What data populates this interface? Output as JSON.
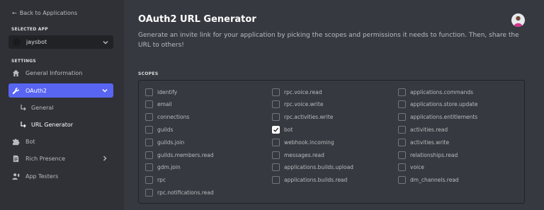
{
  "sidebar": {
    "back_label": "Back to Applications",
    "selected_app_heading": "SELECTED APP",
    "selected_app_name": "jaysbot",
    "settings_heading": "SETTINGS",
    "items": [
      {
        "label": "General Information",
        "icon": "home-icon"
      },
      {
        "label": "OAuth2",
        "icon": "wrench-icon",
        "active": true
      },
      {
        "label": "General",
        "sub": true
      },
      {
        "label": "URL Generator",
        "sub": true,
        "selected": true
      },
      {
        "label": "Bot",
        "icon": "puzzle-icon"
      },
      {
        "label": "Rich Presence",
        "icon": "document-icon",
        "expandable": true
      },
      {
        "label": "App Testers",
        "icon": "user-phone-icon"
      }
    ]
  },
  "main": {
    "title": "OAuth2 URL Generator",
    "description": "Generate an invite link for your application by picking the scopes and permissions it needs to function. Then, share the URL to others!",
    "scopes_heading": "SCOPES",
    "scopes": [
      {
        "label": "identify",
        "checked": false
      },
      {
        "label": "email",
        "checked": false
      },
      {
        "label": "connections",
        "checked": false
      },
      {
        "label": "guilds",
        "checked": false
      },
      {
        "label": "guilds.join",
        "checked": false
      },
      {
        "label": "guilds.members.read",
        "checked": false
      },
      {
        "label": "gdm.join",
        "checked": false
      },
      {
        "label": "rpc",
        "checked": false
      },
      {
        "label": "rpc.notifications.read",
        "checked": false
      },
      {
        "label": "rpc.voice.read",
        "checked": false
      },
      {
        "label": "rpc.voice.write",
        "checked": false
      },
      {
        "label": "rpc.activities.write",
        "checked": false
      },
      {
        "label": "bot",
        "checked": true
      },
      {
        "label": "webhook.incoming",
        "checked": false
      },
      {
        "label": "messages.read",
        "checked": false
      },
      {
        "label": "applications.builds.upload",
        "checked": false
      },
      {
        "label": "applications.builds.read",
        "checked": false
      },
      {
        "label": "applications.commands",
        "checked": false
      },
      {
        "label": "applications.store.update",
        "checked": false
      },
      {
        "label": "applications.entitlements",
        "checked": false
      },
      {
        "label": "activities.read",
        "checked": false
      },
      {
        "label": "activities.write",
        "checked": false
      },
      {
        "label": "relationships.read",
        "checked": false
      },
      {
        "label": "voice",
        "checked": false
      },
      {
        "label": "dm_channels.read",
        "checked": false
      }
    ]
  },
  "colors": {
    "accent": "#5865f2",
    "sidebar_bg": "#2f3136",
    "main_bg": "#36393f"
  }
}
